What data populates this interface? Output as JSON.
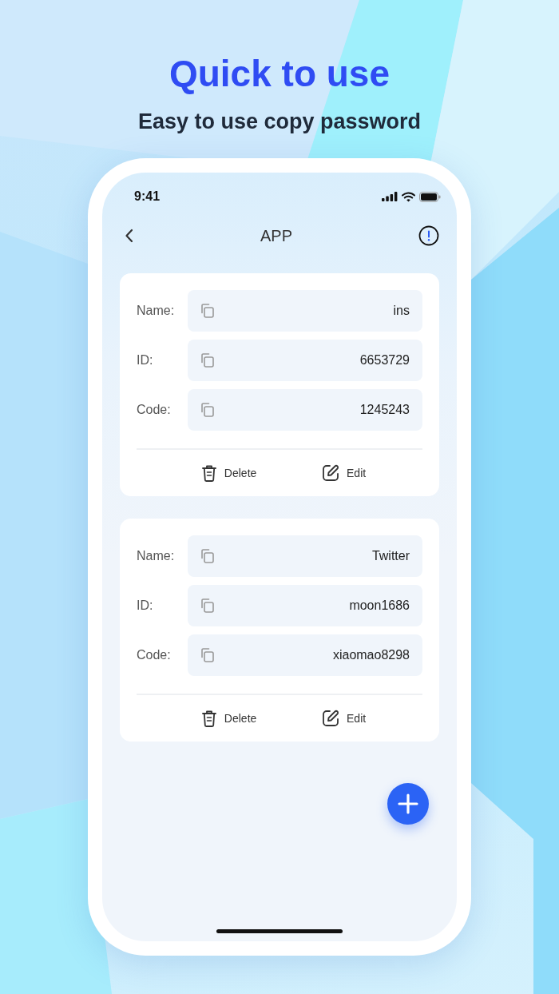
{
  "headline": "Quick to use",
  "subtitle": "Easy to use copy password",
  "status_bar": {
    "time": "9:41"
  },
  "nav": {
    "title": "APP"
  },
  "cards": [
    {
      "fields": [
        {
          "label": "Name:",
          "value": "ins"
        },
        {
          "label": "ID:",
          "value": "6653729"
        },
        {
          "label": "Code:",
          "value": "1245243"
        }
      ],
      "actions": [
        {
          "kind": "delete",
          "label": "Delete"
        },
        {
          "kind": "edit",
          "label": "Edit"
        }
      ]
    },
    {
      "fields": [
        {
          "label": "Name:",
          "value": "Twitter"
        },
        {
          "label": "ID:",
          "value": "moon1686"
        },
        {
          "label": "Code:",
          "value": "xiaomao8298"
        }
      ],
      "actions": [
        {
          "kind": "delete",
          "label": "Delete"
        },
        {
          "kind": "edit",
          "label": "Edit"
        }
      ]
    }
  ]
}
